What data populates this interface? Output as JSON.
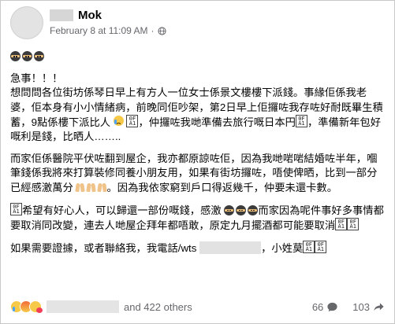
{
  "author": {
    "name": "Mok"
  },
  "post_meta": {
    "timestamp": "February 8 at 11:09 AM",
    "separator": "·"
  },
  "post": {
    "urgent": "急事！！！",
    "para1": "想問問各位街坊係琴日早上有方人一位女士係景文樓樓下派錢。事緣佢係我老婆，佢本身有小小情緒病，前晚同佢吵架，第2日早上佢攞咗我存咗好耐既畢生積蓄，9點係樓下派比人",
    "para1_b": "，仲攞咗我哋準備去旅行嘅日本円",
    "para1_c": "，準備新年包好嘅利是錢，比晒人……..",
    "para2": "而家佢係醫院平伏咗翻到屋企，我亦都原諒咗佢，因為我哋啱啱結婚咗半年，嗰筆錢係我將來打算裝修同養小朋友用，如果有街坊攞咗，唔使俾晒，比到一部分已經感激萬分",
    "para2_b": "。因為我依家窮到戶口得返幾千，仲要未還卡數。",
    "para3_a": "希望有好心人，可以歸還一部份嘅錢，感激",
    "para3_b": "而家因為呢件事好多事情都要取消同改變，連去人哋屋企拜年都唔敢，原定九月擺酒都可能要取消",
    "para4_a": "如果需要證據，或者聯絡我，我電話/wts",
    "para4_b": "，小姓莫"
  },
  "reactions": {
    "others_text": "and 422 others",
    "comments_count": "66",
    "shares_count": "103"
  },
  "icons": [
    "globe-icon",
    "ninja-emoji",
    "crying-emoji",
    "folded-hands-emoji",
    "unicode-box-emoji",
    "comment-icon",
    "share-icon",
    "sad-reaction-icon",
    "angry-reaction-icon",
    "care-reaction-icon"
  ]
}
